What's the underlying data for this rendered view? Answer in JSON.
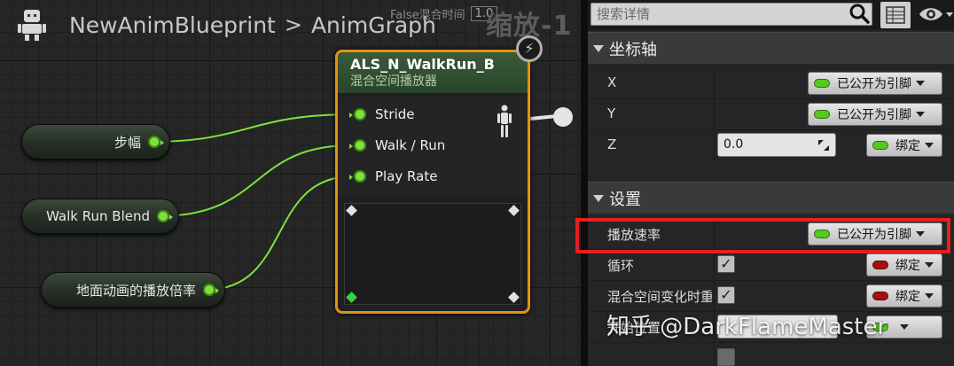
{
  "graph": {
    "breadcrumb": {
      "blueprint": "NewAnimBlueprint",
      "separator": ">",
      "graph": "AnimGraph"
    },
    "overlay": {
      "label": "False混合时间",
      "value": "1.0"
    },
    "zoom": "缩放-1",
    "variable_nodes": [
      {
        "label": "步幅"
      },
      {
        "label": "Walk Run Blend"
      },
      {
        "label": "地面动画的播放倍率"
      }
    ],
    "blend_node": {
      "title": "ALS_N_WalkRun_B",
      "subtitle": "混合空间播放器",
      "pins": [
        "Stride",
        "Walk / Run",
        "Play Rate"
      ]
    }
  },
  "details": {
    "search": {
      "placeholder": "搜索详情"
    },
    "categories": [
      {
        "label": "坐标轴",
        "properties": [
          {
            "name": "X",
            "binding": "已公开为引脚"
          },
          {
            "name": "Y",
            "binding": "已公开为引脚"
          },
          {
            "name": "Z",
            "value": "0.0",
            "binding": "绑定"
          }
        ]
      },
      {
        "label": "设置",
        "properties": [
          {
            "name": "播放速率",
            "binding": "已公开为引脚"
          },
          {
            "name": "循环",
            "checked": true,
            "binding": "绑定"
          },
          {
            "name": "混合空间变化时重",
            "checked": true,
            "binding": "绑定"
          },
          {
            "name": "开始位置"
          }
        ]
      }
    ]
  },
  "watermark": "知乎 @DarkFlameMaster",
  "colors": {
    "pin_green": "#7ee23a",
    "node_border": "#e2920e",
    "highlight": "#e52020"
  }
}
